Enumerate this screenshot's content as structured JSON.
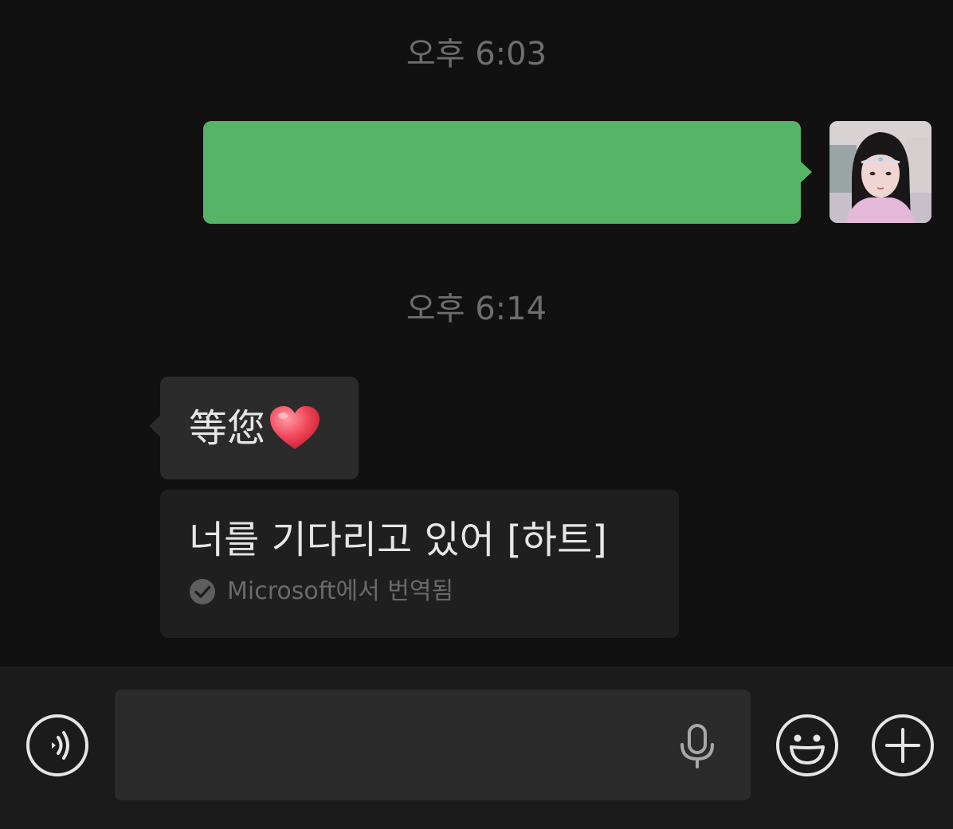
{
  "chat": {
    "timestamps": [
      "오후 6:03",
      "오후 6:14"
    ],
    "outgoing_message": {
      "text": "",
      "bubble_color": "#56b467"
    },
    "incoming_message": {
      "text": "等您",
      "emoji": "heart-icon"
    },
    "translation": {
      "text": "너를 기다리고 있어 [하트]",
      "credit": "Microsoft에서 번역됨",
      "icon": "check-circle-icon"
    }
  },
  "input_bar": {
    "voice_icon": "voice-input-icon",
    "input_value": "",
    "mic_icon": "microphone-icon",
    "emoji_icon": "emoji-icon",
    "plus_icon": "plus-icon"
  },
  "colors": {
    "background": "#111111",
    "incoming_bubble": "#2b2b2b",
    "outgoing_bubble": "#56b467",
    "timestamp": "#6e6e6e",
    "icon": "#e6e6e6"
  }
}
